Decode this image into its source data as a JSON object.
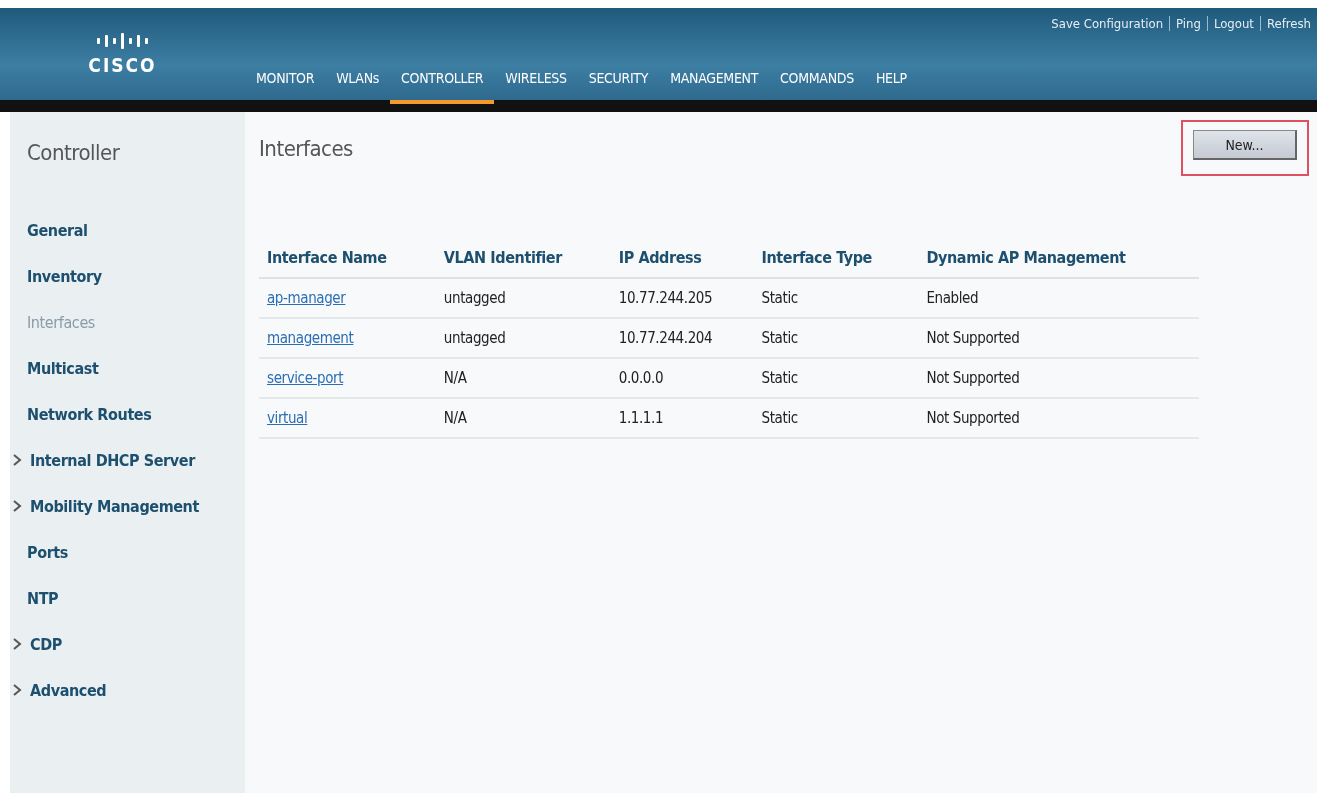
{
  "header": {
    "logo_text": "CISCO",
    "top_links": [
      "Save Configuration",
      "Ping",
      "Logout",
      "Refresh"
    ],
    "menu": [
      {
        "label": "MONITOR",
        "selected": false
      },
      {
        "label": "WLANs",
        "selected": false
      },
      {
        "label": "CONTROLLER",
        "selected": true
      },
      {
        "label": "WIRELESS",
        "selected": false
      },
      {
        "label": "SECURITY",
        "selected": false
      },
      {
        "label": "MANAGEMENT",
        "selected": false
      },
      {
        "label": "COMMANDS",
        "selected": false
      },
      {
        "label": "HELP",
        "selected": false
      }
    ]
  },
  "sidebar": {
    "title": "Controller",
    "items": [
      {
        "label": "General",
        "selected": false,
        "expandable": false
      },
      {
        "label": "Inventory",
        "selected": false,
        "expandable": false
      },
      {
        "label": "Interfaces",
        "selected": true,
        "expandable": false
      },
      {
        "label": "Multicast",
        "selected": false,
        "expandable": false
      },
      {
        "label": "Network Routes",
        "selected": false,
        "expandable": false
      },
      {
        "label": "Internal DHCP Server",
        "selected": false,
        "expandable": true
      },
      {
        "label": "Mobility Management",
        "selected": false,
        "expandable": true
      },
      {
        "label": "Ports",
        "selected": false,
        "expandable": false
      },
      {
        "label": "NTP",
        "selected": false,
        "expandable": false
      },
      {
        "label": "CDP",
        "selected": false,
        "expandable": true
      },
      {
        "label": "Advanced",
        "selected": false,
        "expandable": true
      }
    ]
  },
  "page": {
    "title": "Interfaces",
    "new_button": {
      "label": "New...",
      "highlighted": true
    }
  },
  "table": {
    "columns": [
      "Interface Name",
      "VLAN Identifier",
      "IP Address",
      "Interface Type",
      "Dynamic AP Management"
    ],
    "rows": [
      [
        "ap-manager",
        "untagged",
        "10.77.244.205",
        "Static",
        "Enabled"
      ],
      [
        "management",
        "untagged",
        "10.77.244.204",
        "Static",
        "Not Supported"
      ],
      [
        "service-port",
        "N/A",
        "0.0.0.0",
        "Static",
        "Not Supported"
      ],
      [
        "virtual",
        "N/A",
        "1.1.1.1",
        "Static",
        "Not Supported"
      ]
    ]
  }
}
